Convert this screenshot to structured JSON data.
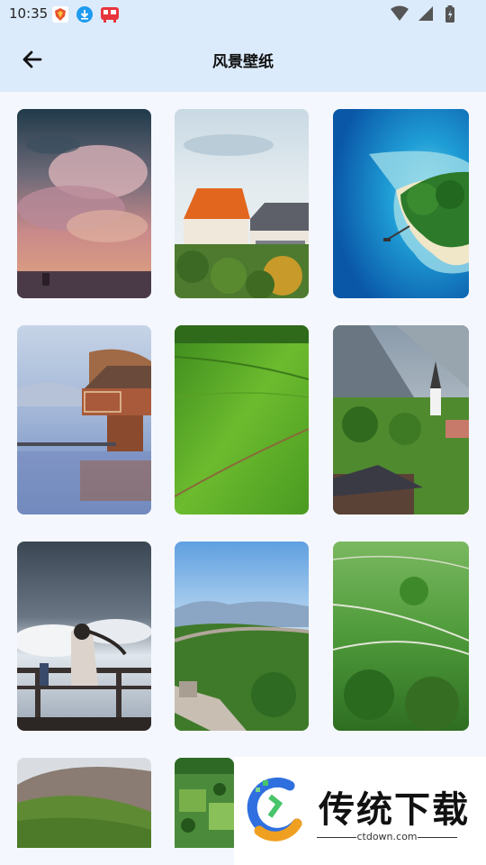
{
  "status_bar": {
    "time": "10:35",
    "notifications": [
      "shield-app-icon",
      "download-app-icon",
      "game-app-icon"
    ],
    "system": [
      "wifi-icon",
      "signal-icon",
      "battery-icon"
    ]
  },
  "app_bar": {
    "back_icon": "arrow-left-icon",
    "title": "风景壁纸"
  },
  "wallpapers": [
    {
      "name": "wallpaper-pink-clouds"
    },
    {
      "name": "wallpaper-orange-roof-town"
    },
    {
      "name": "wallpaper-tropical-island"
    },
    {
      "name": "wallpaper-lake-house"
    },
    {
      "name": "wallpaper-green-field"
    },
    {
      "name": "wallpaper-alpine-village"
    },
    {
      "name": "wallpaper-anime-balcony"
    },
    {
      "name": "wallpaper-great-wall"
    },
    {
      "name": "wallpaper-green-hills-road"
    },
    {
      "name": "wallpaper-mountain-slope"
    },
    {
      "name": "wallpaper-countryside-fields"
    }
  ],
  "watermark": {
    "brand": "传统下载",
    "url": "ctdown.com"
  },
  "colors": {
    "app_bar_bg": "#dcebfb",
    "page_bg": "#f4f7fd"
  }
}
